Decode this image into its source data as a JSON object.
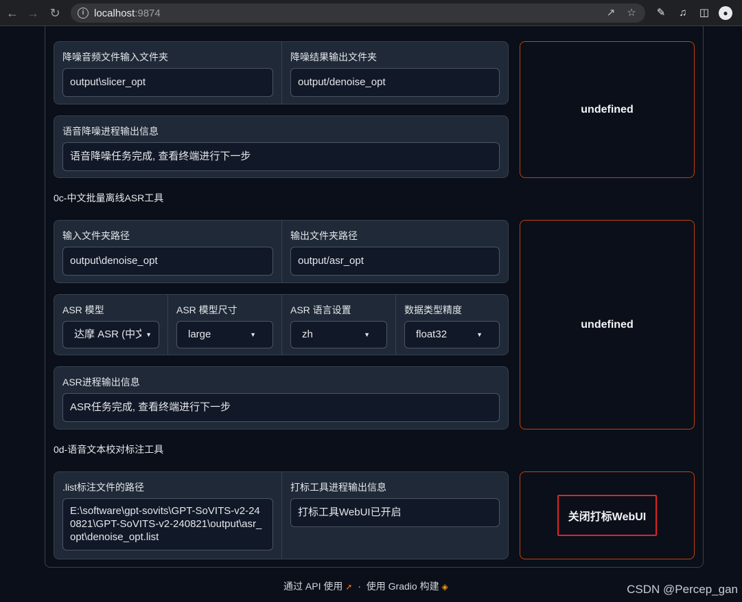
{
  "browser": {
    "url_host": "localhost",
    "url_port": ":9874",
    "nav_back_icon": "arrow-left-icon",
    "nav_forward_icon": "arrow-right-icon",
    "reload_icon": "reload-icon"
  },
  "denoise": {
    "input_label": "降噪音频文件输入文件夹",
    "input_value": "output\\slicer_opt",
    "output_label": "降噪结果输出文件夹",
    "output_value": "output/denoise_opt",
    "info_label": "语音降噪进程输出信息",
    "info_value": "语音降噪任务完成, 查看终端进行下一步",
    "button_label": "undefined"
  },
  "asr": {
    "section_title": "0c-中文批量离线ASR工具",
    "input_label": "输入文件夹路径",
    "input_value": "output\\denoise_opt",
    "output_label": "输出文件夹路径",
    "output_value": "output/asr_opt",
    "model_label": "ASR 模型",
    "model_value": "达摩 ASR (中文)",
    "size_label": "ASR 模型尺寸",
    "size_value": "large",
    "lang_label": "ASR 语言设置",
    "lang_value": "zh",
    "precision_label": "数据类型精度",
    "precision_value": "float32",
    "info_label": "ASR进程输出信息",
    "info_value": "ASR任务完成, 查看终端进行下一步",
    "button_label": "undefined"
  },
  "labeling": {
    "section_title": "0d-语音文本校对标注工具",
    "list_label": ".list标注文件的路径",
    "list_value": "E:\\software\\gpt-sovits\\GPT-SoVITS-v2-240821\\GPT-SoVITS-v2-240821\\output\\asr_opt\\denoise_opt.list",
    "info_label": "打标工具进程输出信息",
    "info_value": "打标工具WebUI已开启",
    "button_label": "关闭打标WebUI"
  },
  "footer": {
    "api_text": "通过 API 使用",
    "sep": "·",
    "built_text": "使用 Gradio 构建"
  },
  "watermark": "CSDN @Percep_gan"
}
